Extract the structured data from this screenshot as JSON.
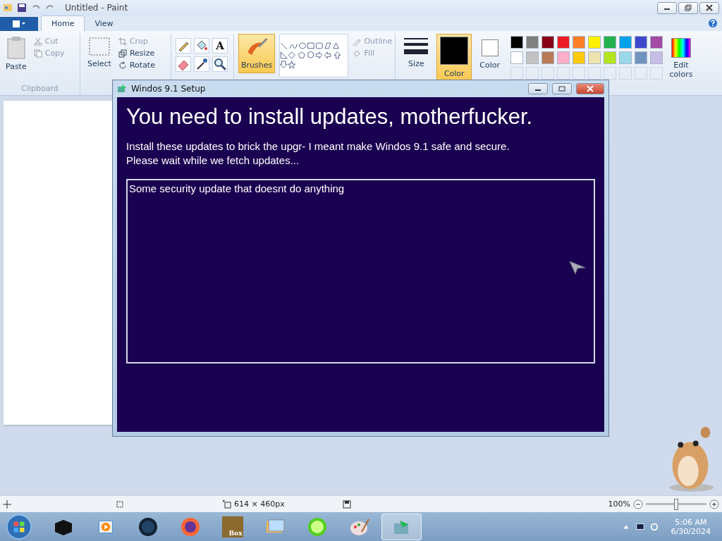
{
  "window": {
    "title": "Untitled - Paint"
  },
  "tabs": [
    {
      "label": "Home",
      "selected": true
    },
    {
      "label": "View",
      "selected": false
    }
  ],
  "ribbon": {
    "clipboard": {
      "paste": "Paste",
      "cut": "Cut",
      "copy": "Copy",
      "group": "Clipboard"
    },
    "image": {
      "select": "Select",
      "crop": "Crop",
      "resize": "Resize",
      "rotate": "Rotate"
    },
    "tools": {
      "text_tool": "A"
    },
    "brushes": {
      "label": "Brushes",
      "selected": true
    },
    "shapes": {
      "outline": "Outline",
      "fill": "Fill"
    },
    "size": "Size",
    "color1": {
      "label": "Color",
      "selected": true,
      "color": "#000000"
    },
    "color2": {
      "label": "Color",
      "selected": false,
      "color": "#ffffff"
    },
    "palette": [
      {
        "color": "#000000"
      },
      {
        "color": "#7f7f7f"
      },
      {
        "color": "#880015"
      },
      {
        "color": "#ed1c24"
      },
      {
        "color": "#ff7f27"
      },
      {
        "color": "#fff200"
      },
      {
        "color": "#22b14c"
      },
      {
        "color": "#00a2e8"
      },
      {
        "color": "#3f48cc"
      },
      {
        "color": "#a349a4"
      },
      {
        "color": "#ffffff"
      },
      {
        "color": "#c3c3c3"
      },
      {
        "color": "#b97a57"
      },
      {
        "color": "#ffaec9"
      },
      {
        "color": "#ffc90e"
      },
      {
        "color": "#efe4b0"
      },
      {
        "color": "#b5e61d"
      },
      {
        "color": "#99d9ea"
      },
      {
        "color": "#7092be"
      },
      {
        "color": "#c8bfe7"
      }
    ],
    "edit_colors": "Edit colors"
  },
  "dialog": {
    "title": "Windos 9.1 Setup",
    "heading": "You need to install updates, motherfucker.",
    "lines": [
      "Install these updates to brick the upgr- I meant make Windos 9.1 safe and secure.",
      "Please wait while we fetch updates..."
    ],
    "list": [
      "Some security update that doesnt do anything"
    ]
  },
  "status_bar": {
    "dimensions": "614 × 460px",
    "zoom": "100%",
    "zoom_slider": {
      "level": 0.5
    }
  },
  "taskbar": {
    "items": [
      {
        "kind": "blackbox",
        "selected": false
      },
      {
        "kind": "media",
        "selected": false
      },
      {
        "kind": "orb",
        "selected": false
      },
      {
        "kind": "browser",
        "selected": false
      },
      {
        "kind": "box",
        "label": "Box",
        "selected": false
      },
      {
        "kind": "photos",
        "selected": false
      },
      {
        "kind": "lime",
        "selected": false
      },
      {
        "kind": "paint",
        "selected": false
      },
      {
        "kind": "setup",
        "selected": true
      }
    ],
    "time": "5:06 AM",
    "date": "6/30/2024"
  }
}
